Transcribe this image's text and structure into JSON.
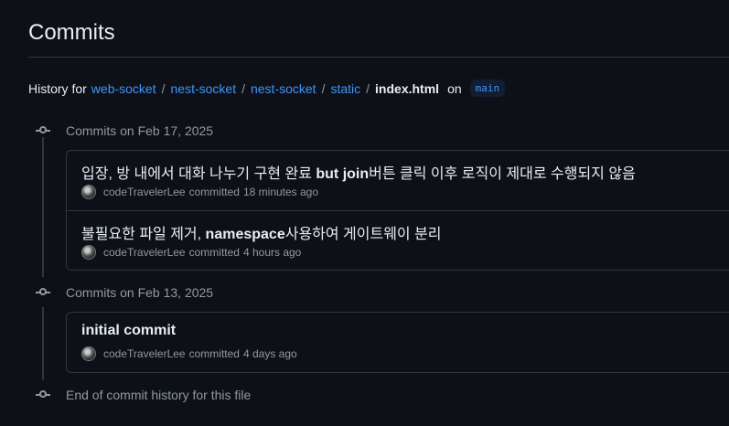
{
  "page": {
    "title": "Commits"
  },
  "history": {
    "prefix": "History for",
    "path": [
      "web-socket",
      "nest-socket",
      "nest-socket",
      "static"
    ],
    "separator": "/",
    "file": "index.html",
    "on": "on",
    "branch": "main"
  },
  "groups": [
    {
      "label": "Commits on Feb 17, 2025",
      "commits": [
        {
          "message_parts": [
            "입장, 방 내에서 대화 나누기 구현 완료 ",
            "but join",
            "버튼 클릭 이후 로직이 제대로 수행되지 않음"
          ],
          "author": "codeTravelerLee",
          "action": "committed",
          "time": "18 minutes ago"
        },
        {
          "message_parts": [
            "불필요한 파일 제거, ",
            "namespace",
            "사용하여 게이트웨이 분리"
          ],
          "author": "codeTravelerLee",
          "action": "committed",
          "time": "4 hours ago"
        }
      ]
    },
    {
      "label": "Commits on Feb 13, 2025",
      "commits": [
        {
          "message_parts": [
            "",
            "initial commit",
            ""
          ],
          "author": "codeTravelerLee",
          "action": "committed",
          "time": "4 days ago"
        }
      ]
    }
  ],
  "footer": {
    "end_text": "End of commit history for this file"
  },
  "colors": {
    "background": "#0d1117",
    "link": "#4493f8",
    "muted": "#9198a1",
    "border": "#30363d"
  },
  "icons": [
    "git-commit-icon",
    "avatar"
  ]
}
